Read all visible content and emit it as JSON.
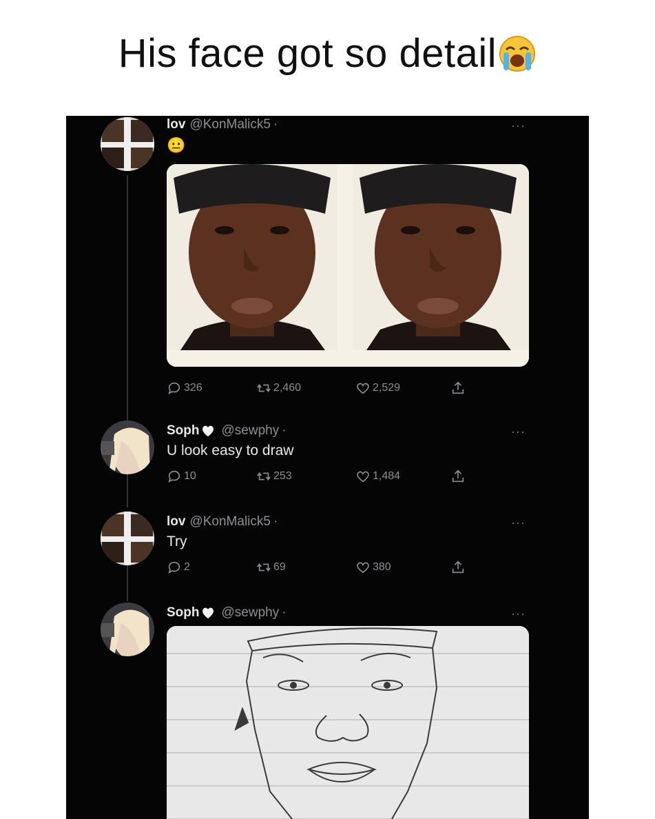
{
  "meme": {
    "caption": "His face got so detail",
    "caption_emoji": "loudly-crying-face"
  },
  "colors": {
    "panel_bg": "#050505",
    "text_primary": "#e7e9ea",
    "text_secondary": "#8b9096",
    "thread_line": "#2f3336"
  },
  "tweets": [
    {
      "display_name": "lov",
      "handle": "@KonMalick5",
      "separator": "·",
      "text": "😐",
      "media": "side-by-side portrait photos",
      "replies": "326",
      "retweets": "2,460",
      "likes": "2,529"
    },
    {
      "display_name": "Soph",
      "handle": "@sewphy",
      "separator": "·",
      "text": "U look easy to draw",
      "replies": "10",
      "retweets": "253",
      "likes": "1,484"
    },
    {
      "display_name": "lov",
      "handle": "@KonMalick5",
      "separator": "·",
      "text": "Try",
      "replies": "2",
      "retweets": "69",
      "likes": "380"
    },
    {
      "display_name": "Soph",
      "handle": "@sewphy",
      "separator": "·",
      "media": "pencil sketch on lined paper"
    }
  ]
}
